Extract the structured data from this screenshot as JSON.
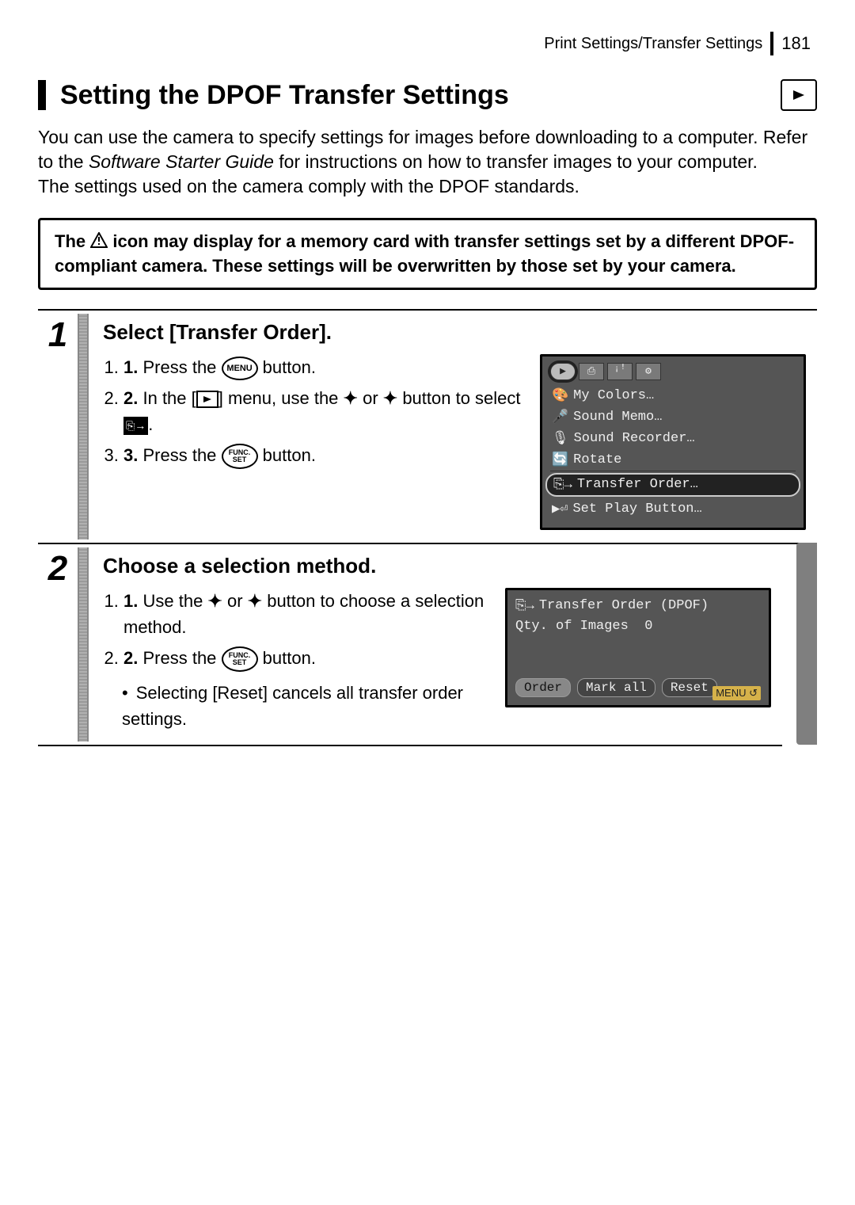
{
  "header": {
    "section": "Print Settings/Transfer Settings",
    "page_number": "181"
  },
  "title": "Setting the DPOF Transfer Settings",
  "intro": {
    "p1a": "You can use the camera to specify settings for images before downloading to a computer. Refer to the ",
    "p1i": "Software Starter Guide",
    "p1b": " for instructions on how to transfer images to your computer.",
    "p2": "The settings used on the camera comply with the DPOF standards."
  },
  "note": {
    "pre": "The ",
    "post": " icon may display for a memory card with transfer settings set by a different DPOF-compliant camera. These settings will be overwritten by those set by your camera."
  },
  "steps": [
    {
      "num": "1",
      "heading": "Select [Transfer Order].",
      "substeps": {
        "s1a": "Press the ",
        "s1_btn": "MENU",
        "s1b": " button.",
        "s2a": "In the [",
        "s2b": "] menu, use the ",
        "s2c": " or ",
        "s2d": " button to select ",
        "s2e": ".",
        "s3a": "Press the ",
        "s3_btn_top": "FUNC.",
        "s3_btn_bot": "SET",
        "s3b": " button."
      },
      "screen": {
        "menu_items": [
          "My Colors…",
          "Sound Memo…",
          "Sound Recorder…",
          "Rotate",
          "Transfer Order…",
          "Set Play Button…"
        ]
      }
    },
    {
      "num": "2",
      "heading": "Choose a selection method.",
      "substeps": {
        "s1a": "Use the ",
        "s1b": " or ",
        "s1c": " button to choose a selection method.",
        "s2a": "Press the ",
        "s2_btn_top": "FUNC.",
        "s2_btn_bot": "SET",
        "s2b": " button."
      },
      "bullet": "Selecting [Reset] cancels all transfer order settings.",
      "screen": {
        "title": "Transfer Order (DPOF)",
        "qty_label": "Qty. of Images",
        "qty_value": "0",
        "options": [
          "Order",
          "Mark all",
          "Reset"
        ],
        "menu_label": "MENU"
      }
    }
  ]
}
